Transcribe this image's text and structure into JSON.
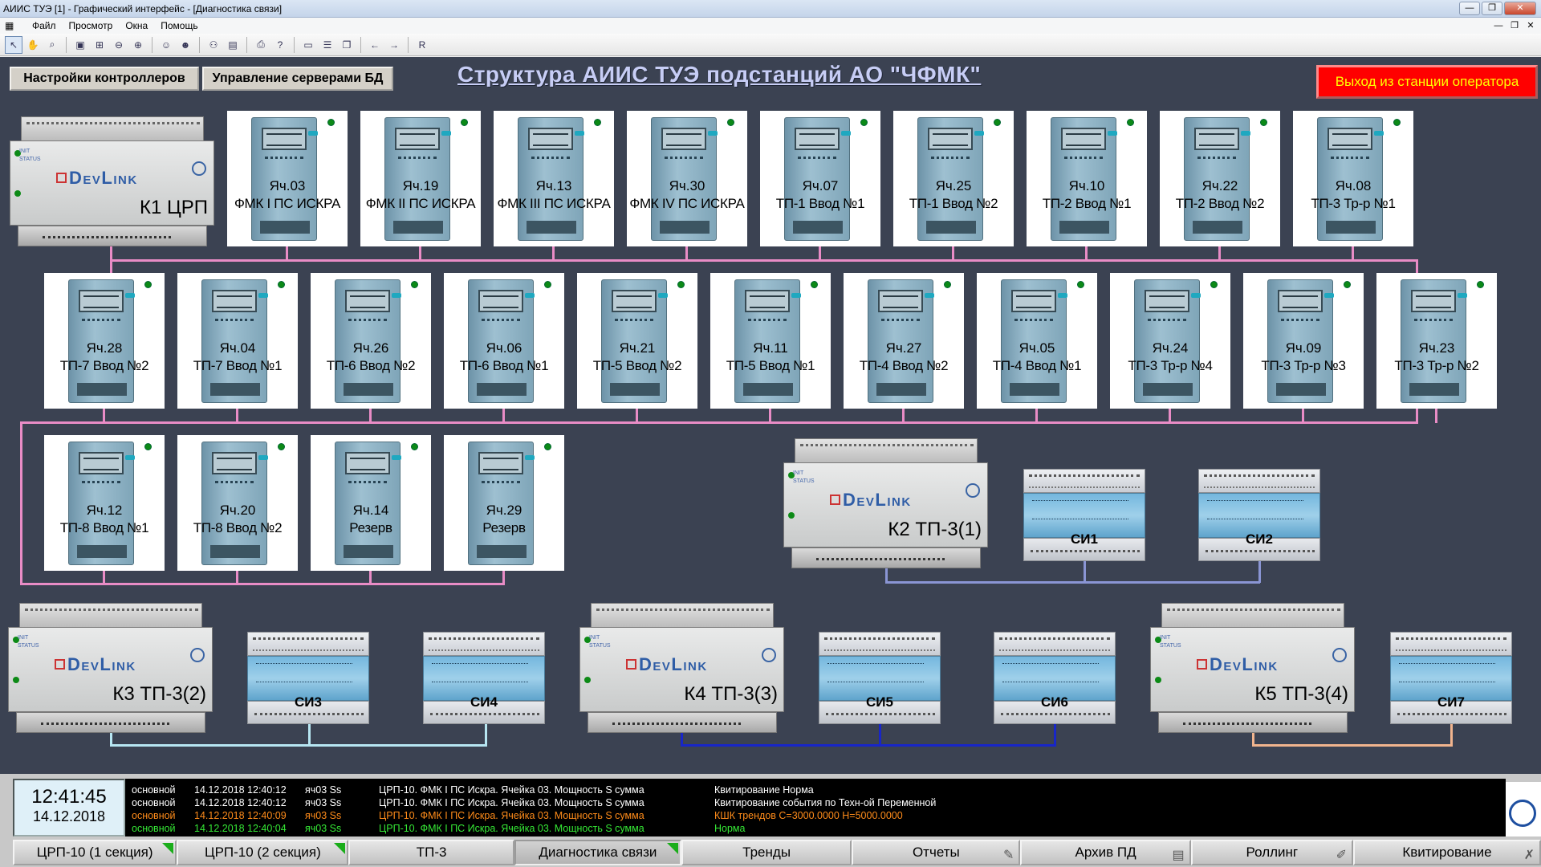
{
  "window": {
    "title": "АИИС ТУЭ [1] - Графический интерфейс - [Диагностика связи]",
    "controls": [
      "—",
      "❐",
      "✕"
    ]
  },
  "menu": {
    "items": [
      "Файл",
      "Просмотр",
      "Окна",
      "Помощь"
    ],
    "right_controls": [
      "—",
      "❐",
      "✕"
    ]
  },
  "toolbar": {
    "last_label": "R"
  },
  "header": {
    "btn_controllers": "Настройки контроллеров",
    "btn_db_servers": "Управление серверами БД",
    "title": "Структура АИИС ТУЭ подстанций АО \"ЧФМК\"",
    "exit": "Выход из станции оператора"
  },
  "controllers": [
    {
      "name": "К1 ЦРП",
      "brand": "DevLink"
    },
    {
      "name": "К2 ТП-3(1)",
      "brand": "DevLink"
    },
    {
      "name": "К3 ТП-3(2)",
      "brand": "DevLink"
    },
    {
      "name": "К4 ТП-3(3)",
      "brand": "DevLink"
    },
    {
      "name": "К5 ТП-3(4)",
      "brand": "DevLink"
    }
  ],
  "meters": [
    {
      "cell": "Яч.03",
      "desc": "ФМК I ПС ИСКРА"
    },
    {
      "cell": "Яч.19",
      "desc": "ФМК II ПС ИСКРА"
    },
    {
      "cell": "Яч.13",
      "desc": "ФМК III ПС ИСКРА"
    },
    {
      "cell": "Яч.30",
      "desc": "ФМК IV ПС ИСКРА"
    },
    {
      "cell": "Яч.07",
      "desc": "ТП-1 Ввод №1"
    },
    {
      "cell": "Яч.25",
      "desc": "ТП-1 Ввод №2"
    },
    {
      "cell": "Яч.10",
      "desc": "ТП-2 Ввод №1"
    },
    {
      "cell": "Яч.22",
      "desc": "ТП-2 Ввод №2"
    },
    {
      "cell": "Яч.08",
      "desc": "ТП-3 Тр-р №1"
    },
    {
      "cell": "Яч.28",
      "desc": "ТП-7 Ввод №2"
    },
    {
      "cell": "Яч.04",
      "desc": "ТП-7 Ввод №1"
    },
    {
      "cell": "Яч.26",
      "desc": "ТП-6 Ввод №2"
    },
    {
      "cell": "Яч.06",
      "desc": "ТП-6 Ввод №1"
    },
    {
      "cell": "Яч.21",
      "desc": "ТП-5 Ввод №2"
    },
    {
      "cell": "Яч.11",
      "desc": "ТП-5 Ввод №1"
    },
    {
      "cell": "Яч.27",
      "desc": "ТП-4 Ввод №2"
    },
    {
      "cell": "Яч.05",
      "desc": "ТП-4 Ввод №1"
    },
    {
      "cell": "Яч.24",
      "desc": "ТП-3 Тр-р №4"
    },
    {
      "cell": "Яч.09",
      "desc": "ТП-3 Тр-р №3"
    },
    {
      "cell": "Яч.23",
      "desc": "ТП-3 Тр-р №2"
    },
    {
      "cell": "Яч.12",
      "desc": "ТП-8 Ввод №1"
    },
    {
      "cell": "Яч.20",
      "desc": "ТП-8 Ввод №2"
    },
    {
      "cell": "Яч.14",
      "desc": "Резерв"
    },
    {
      "cell": "Яч.29",
      "desc": "Резерв"
    }
  ],
  "counters": [
    "СИ1",
    "СИ2",
    "СИ3",
    "СИ4",
    "СИ5",
    "СИ6",
    "СИ7"
  ],
  "colors": {
    "canvas": "#3b4252",
    "line_k1": "#e98cc6",
    "line_k2": "#8a95d4",
    "line_k3": "#b7e6f2",
    "line_k4": "#1826c8",
    "line_k5": "#f1b48e",
    "event_white": "#ffffff",
    "event_orange": "#ff8c1a",
    "event_green": "#35e835",
    "exit_bg": "#ff0000",
    "exit_text": "#ffff00"
  },
  "status": {
    "time": "12:41:45",
    "date": "14.12.2018"
  },
  "events": [
    {
      "src": "основной",
      "datetime": "14.12.2018 12:40:12",
      "tag": "яч03 Ss",
      "object": "ЦРП-10. ФМК I ПС Искра. Ячейка 03. Мощность S сумма",
      "message": "Квитирование Норма",
      "color": "#ffffff"
    },
    {
      "src": "основной",
      "datetime": "14.12.2018 12:40:12",
      "tag": "яч03 Ss",
      "object": "ЦРП-10. ФМК I ПС Искра. Ячейка 03. Мощность S сумма",
      "message": "Квитирование события по Техн-ой Переменной",
      "color": "#ffffff"
    },
    {
      "src": "основной",
      "datetime": "14.12.2018 12:40:09",
      "tag": "яч03 Ss",
      "object": "ЦРП-10. ФМК I ПС Искра. Ячейка 03. Мощность S сумма",
      "message": "КШК трендов С=3000.0000 Н=5000.0000",
      "color": "#ff8c1a"
    },
    {
      "src": "основной",
      "datetime": "14.12.2018 12:40:04",
      "tag": "яч03 Ss",
      "object": "ЦРП-10. ФМК I ПС Искра. Ячейка 03. Мощность S сумма",
      "message": "Норма",
      "color": "#35e835"
    }
  ],
  "tabs": [
    {
      "label": "ЦРП-10 (1 секция)",
      "flag": true,
      "icon": "",
      "selected": false
    },
    {
      "label": "ЦРП-10 (2 секция)",
      "flag": true,
      "icon": "",
      "selected": false
    },
    {
      "label": "ТП-3",
      "flag": false,
      "icon": "",
      "selected": false
    },
    {
      "label": "Диагностика связи",
      "flag": true,
      "icon": "",
      "selected": true
    },
    {
      "label": "Тренды",
      "flag": false,
      "icon": "",
      "selected": false
    },
    {
      "label": "Отчеты",
      "flag": false,
      "icon": "report-icon",
      "selected": false
    },
    {
      "label": "Архив ПД",
      "flag": false,
      "icon": "archive-icon",
      "selected": false
    },
    {
      "label": "Роллинг",
      "flag": false,
      "icon": "pen-icon",
      "selected": false
    },
    {
      "label": "Квитирование",
      "flag": false,
      "icon": "ack-icon",
      "selected": false
    }
  ]
}
